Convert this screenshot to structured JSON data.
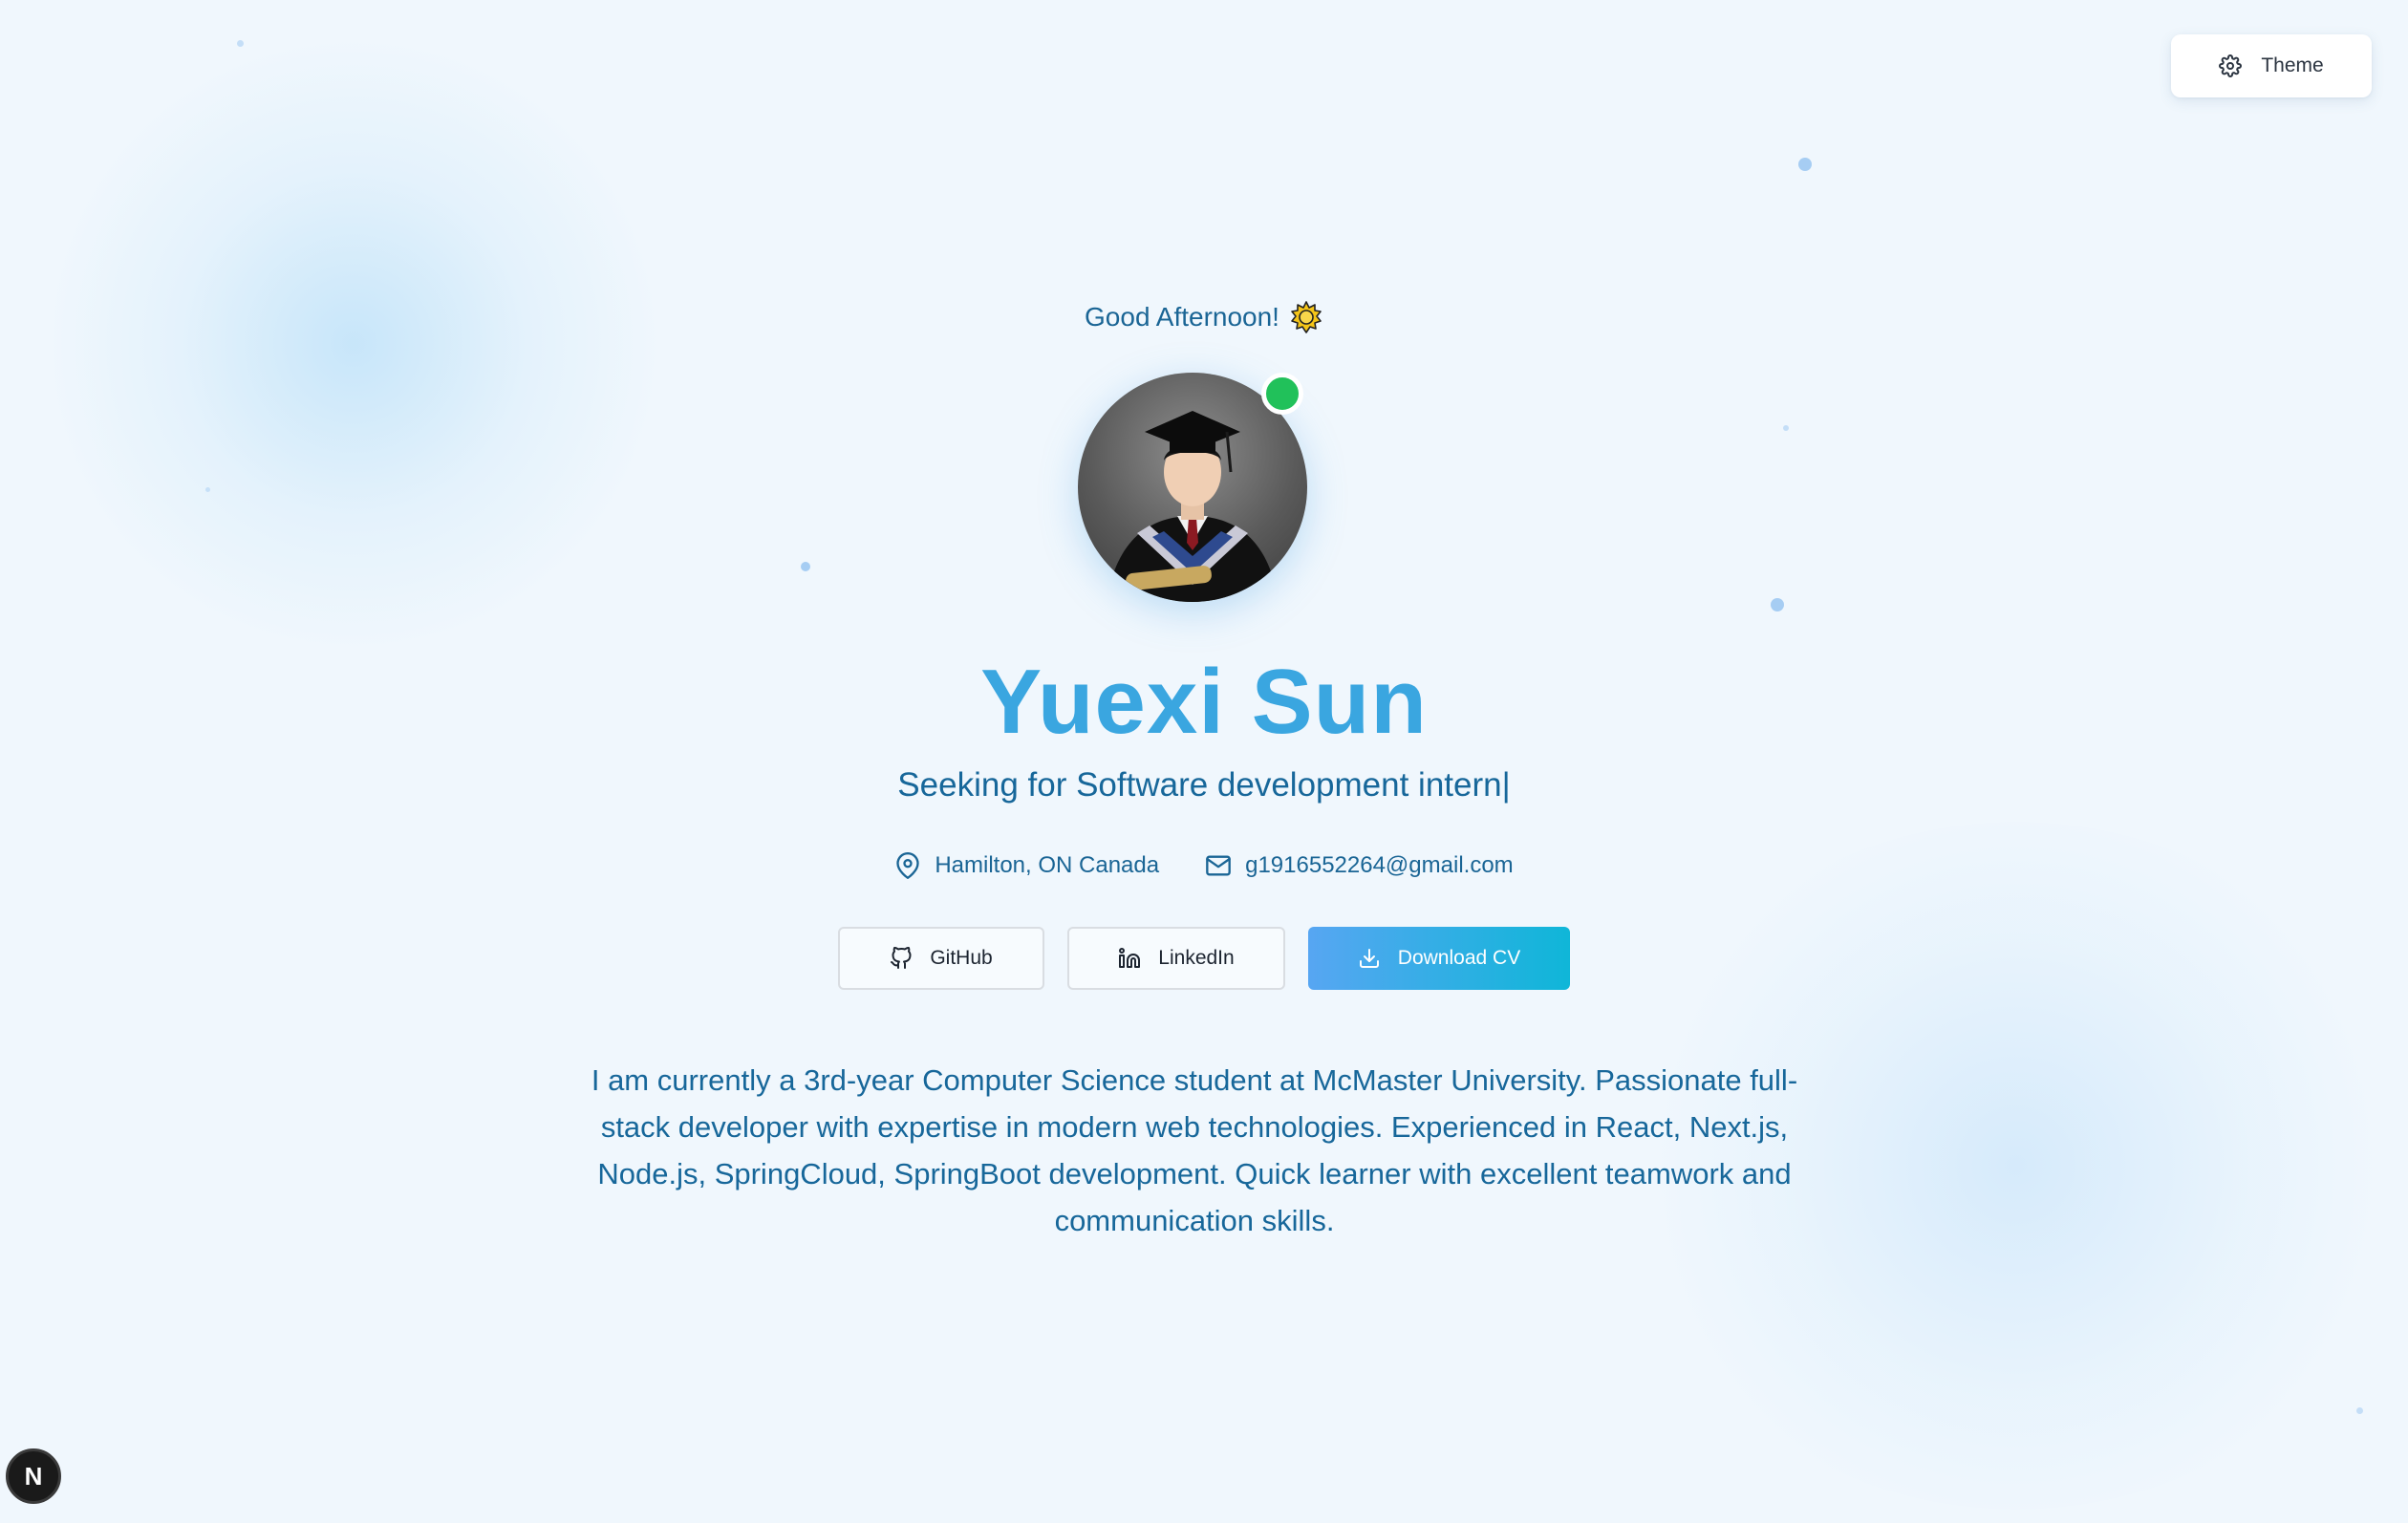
{
  "theme_button": {
    "label": "Theme",
    "icon": "gear-icon"
  },
  "hero": {
    "greeting": "Good Afternoon!",
    "greeting_icon": "sun-icon",
    "avatar_alt": "profile-photo",
    "status": "online",
    "name": "Yuexi Sun",
    "tagline": "Seeking for Software development intern",
    "cursor": "|"
  },
  "contact": {
    "location": "Hamilton, ON Canada",
    "email": "g1916552264@gmail.com"
  },
  "buttons": {
    "github": "GitHub",
    "linkedin": "LinkedIn",
    "download": "Download CV"
  },
  "bio": "I am currently a 3rd-year Computer Science student at McMaster University. Passionate full-stack developer with expertise in modern web technologies. Experienced in React, Next.js, Node.js, SpringCloud, SpringBoot development. Quick learner with excellent teamwork and communication skills.",
  "dev_badge": {
    "label": "N"
  },
  "colors": {
    "background": "#f0f7fd",
    "name": "#3aa6e0",
    "text": "#17679a",
    "status": "#21c15a",
    "primary_gradient_start": "#57a6f2",
    "primary_gradient_end": "#0fb6d8"
  }
}
